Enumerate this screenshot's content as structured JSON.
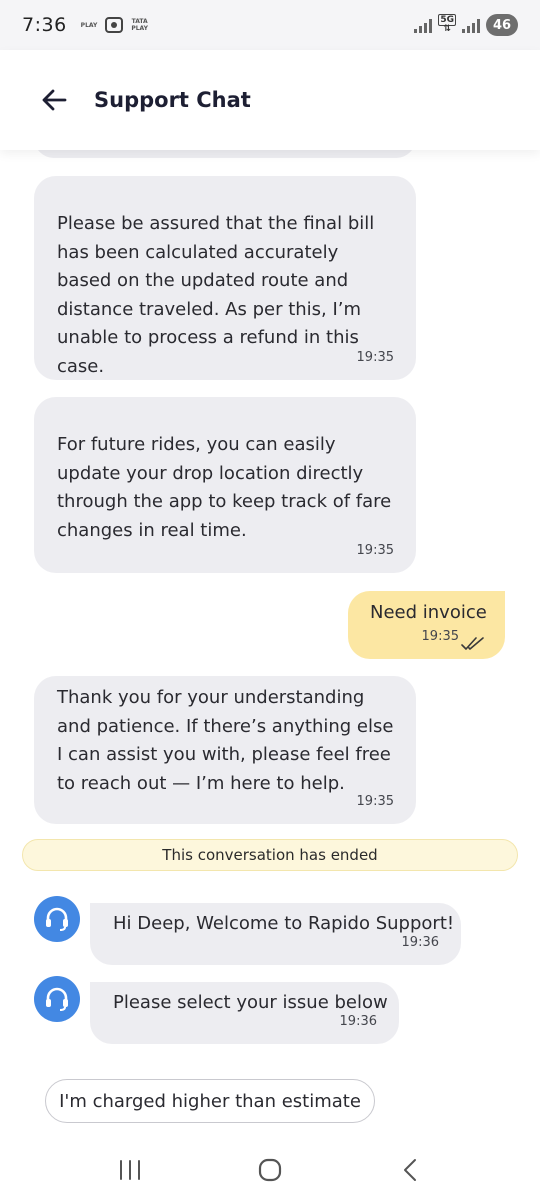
{
  "status_bar": {
    "time": "7:36",
    "left_tag_1": "PLAY",
    "left_tag_2_top": "TATA",
    "left_tag_2_bottom": "PLAY",
    "network": "5G",
    "battery": "46"
  },
  "header": {
    "title": "Support Chat"
  },
  "messages": [
    {
      "text": "Please be assured that the final bill has been calculated accurately based on the updated route and distance traveled. As per this, I’m unable to process a refund in this case.",
      "time": "19:35"
    },
    {
      "text": "For future rides, you can easily update your drop location directly through the app to keep track of fare changes in real time.",
      "time": "19:35"
    },
    {
      "text": "Need invoice",
      "time": "19:35"
    },
    {
      "text": "Thank you for your understanding and patience. If there’s anything else I can assist you with, please feel free to reach out — I’m here to help.",
      "time": "19:35"
    }
  ],
  "ended_banner": "This conversation has ended",
  "bot_messages": [
    {
      "text": "Hi Deep, Welcome to Rapido Support!",
      "time": "19:36"
    },
    {
      "text": "Please select your issue below",
      "time": "19:36"
    }
  ],
  "option": "I'm charged higher than estimate",
  "colors": {
    "sent_bubble": "#fce7a3",
    "received_bubble": "#ededf1",
    "avatar": "#4388e3",
    "banner": "#fdf7dc"
  }
}
